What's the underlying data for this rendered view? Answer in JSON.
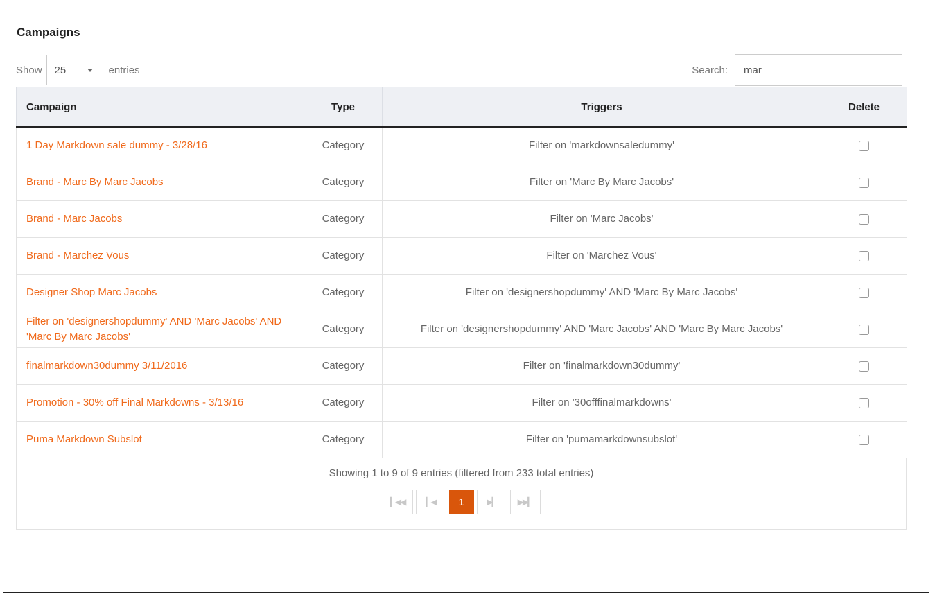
{
  "panel": {
    "title": "Campaigns"
  },
  "length_menu": {
    "show_label": "Show",
    "value": "25",
    "entries_label": "entries"
  },
  "search": {
    "label": "Search:",
    "value": "mar"
  },
  "table": {
    "headers": {
      "campaign": "Campaign",
      "type": "Type",
      "triggers": "Triggers",
      "delete": "Delete"
    },
    "rows": [
      {
        "campaign": "1 Day Markdown sale dummy - 3/28/16",
        "type": "Category",
        "triggers": "Filter on 'markdownsaledummy'",
        "checked": false
      },
      {
        "campaign": "Brand - Marc By Marc Jacobs",
        "type": "Category",
        "triggers": "Filter on 'Marc By Marc Jacobs'",
        "checked": false
      },
      {
        "campaign": "Brand - Marc Jacobs",
        "type": "Category",
        "triggers": "Filter on 'Marc Jacobs'",
        "checked": false
      },
      {
        "campaign": "Brand - Marchez Vous",
        "type": "Category",
        "triggers": "Filter on 'Marchez Vous'",
        "checked": false
      },
      {
        "campaign": "Designer Shop Marc Jacobs",
        "type": "Category",
        "triggers": "Filter on 'designershopdummy' AND 'Marc By Marc Jacobs'",
        "checked": false
      },
      {
        "campaign": "Filter on 'designershopdummy' AND 'Marc Jacobs' AND 'Marc By Marc Jacobs'",
        "type": "Category",
        "triggers": "Filter on 'designershopdummy' AND 'Marc Jacobs' AND 'Marc By Marc Jacobs'",
        "checked": false
      },
      {
        "campaign": "finalmarkdown30dummy 3/11/2016",
        "type": "Category",
        "triggers": "Filter on 'finalmarkdown30dummy'",
        "checked": false
      },
      {
        "campaign": "Promotion - 30% off Final Markdowns - 3/13/16",
        "type": "Category",
        "triggers": "Filter on '30offfinalmarkdowns'",
        "checked": false
      },
      {
        "campaign": "Puma Markdown Subslot",
        "type": "Category",
        "triggers": "Filter on 'pumamarkdownsubslot'",
        "checked": false
      }
    ]
  },
  "footer": {
    "info": "Showing 1 to 9 of 9 entries (filtered from 233 total entries)"
  },
  "pagination": {
    "first_icon": "first-page-icon",
    "prev_icon": "previous-page-icon",
    "current_page": "1",
    "next_icon": "next-page-icon",
    "last_icon": "last-page-icon"
  },
  "colors": {
    "link": "#f06a1c",
    "active_page": "#d9560b",
    "header_bg": "#eef0f4"
  }
}
